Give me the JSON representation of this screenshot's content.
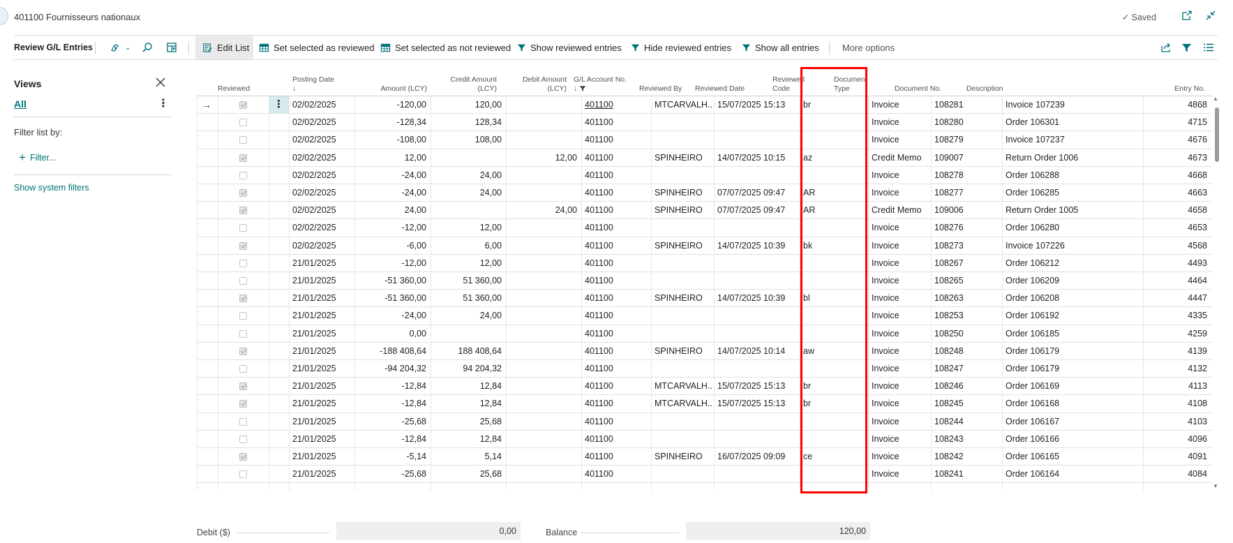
{
  "header": {
    "title": "401100 Fournisseurs nationaux",
    "saved_status": "Saved"
  },
  "toolbar": {
    "page_caption": "Review G/L Entries",
    "edit_list": "Edit List",
    "set_reviewed": "Set selected as reviewed",
    "set_not_reviewed": "Set selected as not reviewed",
    "show_reviewed": "Show reviewed entries",
    "hide_reviewed": "Hide reviewed entries",
    "show_all": "Show all entries",
    "more_options": "More options"
  },
  "views": {
    "title": "Views",
    "all_label": "All",
    "filter_by": "Filter list by:",
    "add_filter": "Filter...",
    "show_system_filters": "Show system filters"
  },
  "columns": {
    "reviewed": "Reviewed",
    "posting_date": "Posting Date",
    "amount": "Amount (LCY)",
    "credit_1": "Credit Amount",
    "credit_2": "(LCY)",
    "debit_1": "Debit Amount",
    "debit_2": "(LCY)",
    "gl_account": "G/L Account No.",
    "reviewed_by": "Reviewed By",
    "reviewed_date": "Reviewed Date",
    "reviewed_code_1": "Reviewed",
    "reviewed_code_2": "Code",
    "doc_type_1": "Document",
    "doc_type_2": "Type",
    "doc_no": "Document No.",
    "description": "Description",
    "entry_no": "Entry No."
  },
  "rows": [
    {
      "reviewed": true,
      "date": "02/02/2025",
      "amount": "-120,00",
      "credit": "120,00",
      "debit": "",
      "account": "401100",
      "by": "MTCARVALH...",
      "rdate": "15/07/2025 15:13",
      "code": "br",
      "type": "Invoice",
      "docno": "108281",
      "desc": "Invoice 107239",
      "entry": "4868"
    },
    {
      "reviewed": false,
      "date": "02/02/2025",
      "amount": "-128,34",
      "credit": "128,34",
      "debit": "",
      "account": "401100",
      "by": "",
      "rdate": "",
      "code": "",
      "type": "Invoice",
      "docno": "108280",
      "desc": "Order 106301",
      "entry": "4715"
    },
    {
      "reviewed": false,
      "date": "02/02/2025",
      "amount": "-108,00",
      "credit": "108,00",
      "debit": "",
      "account": "401100",
      "by": "",
      "rdate": "",
      "code": "",
      "type": "Invoice",
      "docno": "108279",
      "desc": "Invoice 107237",
      "entry": "4676"
    },
    {
      "reviewed": true,
      "date": "02/02/2025",
      "amount": "12,00",
      "credit": "",
      "debit": "12,00",
      "account": "401100",
      "by": "SPINHEIRO",
      "rdate": "14/07/2025 10:15",
      "code": "az",
      "type": "Credit Memo",
      "docno": "109007",
      "desc": "Return Order 1006",
      "entry": "4673"
    },
    {
      "reviewed": false,
      "date": "02/02/2025",
      "amount": "-24,00",
      "credit": "24,00",
      "debit": "",
      "account": "401100",
      "by": "",
      "rdate": "",
      "code": "",
      "type": "Invoice",
      "docno": "108278",
      "desc": "Order 106288",
      "entry": "4668"
    },
    {
      "reviewed": true,
      "date": "02/02/2025",
      "amount": "-24,00",
      "credit": "24,00",
      "debit": "",
      "account": "401100",
      "by": "SPINHEIRO",
      "rdate": "07/07/2025 09:47",
      "code": "AR",
      "type": "Invoice",
      "docno": "108277",
      "desc": "Order 106285",
      "entry": "4663"
    },
    {
      "reviewed": true,
      "date": "02/02/2025",
      "amount": "24,00",
      "credit": "",
      "debit": "24,00",
      "account": "401100",
      "by": "SPINHEIRO",
      "rdate": "07/07/2025 09:47",
      "code": "AR",
      "type": "Credit Memo",
      "docno": "109006",
      "desc": "Return Order 1005",
      "entry": "4658"
    },
    {
      "reviewed": false,
      "date": "02/02/2025",
      "amount": "-12,00",
      "credit": "12,00",
      "debit": "",
      "account": "401100",
      "by": "",
      "rdate": "",
      "code": "",
      "type": "Invoice",
      "docno": "108276",
      "desc": "Order 106280",
      "entry": "4653"
    },
    {
      "reviewed": true,
      "date": "02/02/2025",
      "amount": "-6,00",
      "credit": "6,00",
      "debit": "",
      "account": "401100",
      "by": "SPINHEIRO",
      "rdate": "14/07/2025 10:39",
      "code": "bk",
      "type": "Invoice",
      "docno": "108273",
      "desc": "Invoice 107226",
      "entry": "4568"
    },
    {
      "reviewed": false,
      "date": "21/01/2025",
      "amount": "-12,00",
      "credit": "12,00",
      "debit": "",
      "account": "401100",
      "by": "",
      "rdate": "",
      "code": "",
      "type": "Invoice",
      "docno": "108267",
      "desc": "Order 106212",
      "entry": "4493"
    },
    {
      "reviewed": false,
      "date": "21/01/2025",
      "amount": "-51 360,00",
      "credit": "51 360,00",
      "debit": "",
      "account": "401100",
      "by": "",
      "rdate": "",
      "code": "",
      "type": "Invoice",
      "docno": "108265",
      "desc": "Order 106209",
      "entry": "4464"
    },
    {
      "reviewed": true,
      "date": "21/01/2025",
      "amount": "-51 360,00",
      "credit": "51 360,00",
      "debit": "",
      "account": "401100",
      "by": "SPINHEIRO",
      "rdate": "14/07/2025 10:39",
      "code": "bl",
      "type": "Invoice",
      "docno": "108263",
      "desc": "Order 106208",
      "entry": "4447"
    },
    {
      "reviewed": false,
      "date": "21/01/2025",
      "amount": "-24,00",
      "credit": "24,00",
      "debit": "",
      "account": "401100",
      "by": "",
      "rdate": "",
      "code": "",
      "type": "Invoice",
      "docno": "108253",
      "desc": "Order 106192",
      "entry": "4335"
    },
    {
      "reviewed": false,
      "date": "21/01/2025",
      "amount": "0,00",
      "credit": "",
      "debit": "",
      "account": "401100",
      "by": "",
      "rdate": "",
      "code": "",
      "type": "Invoice",
      "docno": "108250",
      "desc": "Order 106185",
      "entry": "4259"
    },
    {
      "reviewed": true,
      "date": "21/01/2025",
      "amount": "-188 408,64",
      "credit": "188 408,64",
      "debit": "",
      "account": "401100",
      "by": "SPINHEIRO",
      "rdate": "14/07/2025 10:14",
      "code": "aw",
      "type": "Invoice",
      "docno": "108248",
      "desc": "Order 106179",
      "entry": "4139"
    },
    {
      "reviewed": false,
      "date": "21/01/2025",
      "amount": "-94 204,32",
      "credit": "94 204,32",
      "debit": "",
      "account": "401100",
      "by": "",
      "rdate": "",
      "code": "",
      "type": "Invoice",
      "docno": "108247",
      "desc": "Order 106179",
      "entry": "4132"
    },
    {
      "reviewed": true,
      "date": "21/01/2025",
      "amount": "-12,84",
      "credit": "12,84",
      "debit": "",
      "account": "401100",
      "by": "MTCARVALH...",
      "rdate": "15/07/2025 15:13",
      "code": "br",
      "type": "Invoice",
      "docno": "108246",
      "desc": "Order 106169",
      "entry": "4113"
    },
    {
      "reviewed": true,
      "date": "21/01/2025",
      "amount": "-12,84",
      "credit": "12,84",
      "debit": "",
      "account": "401100",
      "by": "MTCARVALH...",
      "rdate": "15/07/2025 15:13",
      "code": "br",
      "type": "Invoice",
      "docno": "108245",
      "desc": "Order 106168",
      "entry": "4108"
    },
    {
      "reviewed": false,
      "date": "21/01/2025",
      "amount": "-25,68",
      "credit": "25,68",
      "debit": "",
      "account": "401100",
      "by": "",
      "rdate": "",
      "code": "",
      "type": "Invoice",
      "docno": "108244",
      "desc": "Order 106167",
      "entry": "4103"
    },
    {
      "reviewed": false,
      "date": "21/01/2025",
      "amount": "-12,84",
      "credit": "12,84",
      "debit": "",
      "account": "401100",
      "by": "",
      "rdate": "",
      "code": "",
      "type": "Invoice",
      "docno": "108243",
      "desc": "Order 106166",
      "entry": "4096"
    },
    {
      "reviewed": true,
      "date": "21/01/2025",
      "amount": "-5,14",
      "credit": "5,14",
      "debit": "",
      "account": "401100",
      "by": "SPINHEIRO",
      "rdate": "16/07/2025 09:09",
      "code": "ce",
      "type": "Invoice",
      "docno": "108242",
      "desc": "Order 106165",
      "entry": "4091"
    },
    {
      "reviewed": false,
      "date": "21/01/2025",
      "amount": "-25,68",
      "credit": "25,68",
      "debit": "",
      "account": "401100",
      "by": "",
      "rdate": "",
      "code": "",
      "type": "Invoice",
      "docno": "108241",
      "desc": "Order 106164",
      "entry": "4084"
    }
  ],
  "totals": {
    "debit_label": "Debit ($)",
    "debit_value": "0,00",
    "balance_label": "Balance",
    "balance_value": "120,00"
  },
  "colors": {
    "accent": "#00707a",
    "highlight": "#ff0000",
    "selected_cell": "#d5eaec"
  }
}
